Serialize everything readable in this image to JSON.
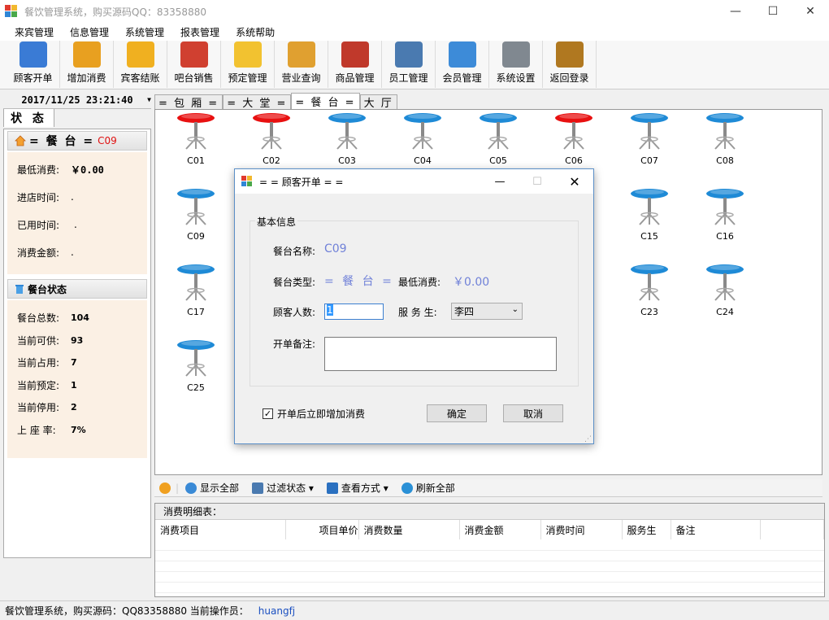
{
  "window": {
    "title": "餐饮管理系统，购买源码QQ：83358880",
    "controls": [
      "—",
      "☐",
      "✕"
    ]
  },
  "menu": [
    "来宾管理",
    "信息管理",
    "系统管理",
    "报表管理",
    "系统帮助"
  ],
  "toolbar": [
    {
      "label": "顾客开单",
      "icon": "customer-open-icon",
      "color": "#3a7bd5"
    },
    {
      "label": "增加消费",
      "icon": "add-consume-icon",
      "color": "#e8a020"
    },
    {
      "label": "宾客结账",
      "icon": "checkout-icon",
      "color": "#f0b020"
    },
    {
      "label": "吧台销售",
      "icon": "bar-sales-icon",
      "color": "#d04030"
    },
    {
      "label": "预定管理",
      "icon": "reservation-icon",
      "color": "#f2c230"
    },
    {
      "label": "营业查询",
      "icon": "query-icon",
      "color": "#e0a030"
    },
    {
      "label": "商品管理",
      "icon": "goods-icon",
      "color": "#c0392b"
    },
    {
      "label": "员工管理",
      "icon": "staff-icon",
      "color": "#4a7ab0"
    },
    {
      "label": "会员管理",
      "icon": "member-icon",
      "color": "#3d8bd8"
    },
    {
      "label": "系统设置",
      "icon": "settings-icon",
      "color": "#808890"
    },
    {
      "label": "返回登录",
      "icon": "exit-icon",
      "color": "#b07820"
    }
  ],
  "datetime": "2017/11/25 23:21:40",
  "status_tab": "状 态",
  "current_table": {
    "header_label": "= 餐 台 =",
    "code": "C09",
    "min_consume_label": "最低消费:",
    "min_consume": "￥0.00",
    "enter_time_label": "进店时间:",
    "enter_time": ".",
    "used_time_label": "已用时间:",
    "used_time": ".",
    "amount_label": "消费金额:",
    "amount": "."
  },
  "table_status": {
    "header": "餐台状态",
    "rows": [
      {
        "label": "餐台总数:",
        "value": "104"
      },
      {
        "label": "当前可供:",
        "value": "93"
      },
      {
        "label": "当前占用:",
        "value": "7"
      },
      {
        "label": "当前预定:",
        "value": "1"
      },
      {
        "label": "当前停用:",
        "value": "2"
      },
      {
        "label": "上 座 率:",
        "value": "7%"
      }
    ]
  },
  "tabs": [
    "= 包 厢 =",
    "= 大 堂 =",
    "= 餐 台 =",
    "大 厅"
  ],
  "active_tab": 2,
  "tables": [
    {
      "code": "C01",
      "status": "occupied"
    },
    {
      "code": "C02",
      "status": "occupied"
    },
    {
      "code": "C03",
      "status": "free"
    },
    {
      "code": "C04",
      "status": "free"
    },
    {
      "code": "C05",
      "status": "free"
    },
    {
      "code": "C06",
      "status": "occupied"
    },
    {
      "code": "C07",
      "status": "free"
    },
    {
      "code": "C08",
      "status": "free"
    },
    {
      "code": "C09",
      "status": "free"
    },
    {
      "code": "C15",
      "status": "free"
    },
    {
      "code": "C16",
      "status": "free"
    },
    {
      "code": "C17",
      "status": "free"
    },
    {
      "code": "C23",
      "status": "free"
    },
    {
      "code": "C24",
      "status": "free"
    },
    {
      "code": "C25",
      "status": "free"
    }
  ],
  "status_colors": {
    "occupied": "#e81010",
    "free": "#1e8ad6"
  },
  "bottom_toolbar": [
    {
      "label": "",
      "icon": "down-arrow-icon"
    },
    {
      "label": "显示全部",
      "icon": "show-all-icon"
    },
    {
      "label": "过滤状态 ▾",
      "icon": "filter-icon"
    },
    {
      "label": "查看方式 ▾",
      "icon": "view-icon"
    },
    {
      "label": "刷新全部",
      "icon": "refresh-icon"
    }
  ],
  "detail": {
    "title": "消费明细表：",
    "columns": [
      "消费项目",
      "项目单价",
      "消费数量",
      "消费金额",
      "消费时间",
      "服务生",
      "备注"
    ]
  },
  "statusbar": {
    "text": "餐饮管理系统，购买源码：QQ83358880  当前操作员：",
    "operator": "huangfj"
  },
  "dialog": {
    "title": "= = 顾客开单 = =",
    "group_title": "基本信息",
    "name_label": "餐台名称:",
    "name_value": "C09",
    "type_label": "餐台类型:",
    "type_value": "= 餐 台 =",
    "min_label": "最低消费:",
    "min_value": "￥0.00",
    "people_label": "顾客人数:",
    "people_value": "1",
    "waiter_label": "服 务 生:",
    "waiter_value": "李四",
    "remark_label": "开单备注:",
    "remark_value": "",
    "checkbox_label": "开单后立即增加消费",
    "checkbox_checked": true,
    "ok_label": "确定",
    "cancel_label": "取消"
  }
}
